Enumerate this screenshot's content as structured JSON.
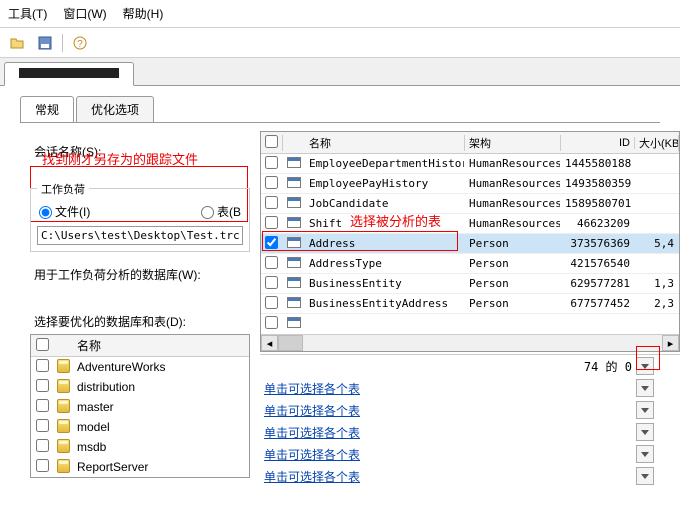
{
  "menu": {
    "tools": "工具(T)",
    "window": "窗口(W)",
    "help": "帮助(H)"
  },
  "tabs": {
    "general": "常规",
    "optimize": "优化选项"
  },
  "session": {
    "label": "会话名称(S):",
    "note_find_file": "找到刚才另存为的跟踪文件",
    "workload_title": "工作负荷",
    "radio_file": "文件(I)",
    "radio_table": "表(B",
    "file_value": "C:\\Users\\test\\Desktop\\Test.trc",
    "db_for_analysis": "用于工作负荷分析的数据库(W):",
    "select_db_tables": "选择要优化的数据库和表(D):"
  },
  "headers": {
    "name": "名称",
    "schema": "架构",
    "id": "ID",
    "size": "大小(KB"
  },
  "note_select_table": "选择被分析的表",
  "tables": [
    {
      "checked": false,
      "name": "EmployeeDepartmentHistory",
      "schema": "HumanResources",
      "id": "1445580188",
      "size": ""
    },
    {
      "checked": false,
      "name": "EmployeePayHistory",
      "schema": "HumanResources",
      "id": "1493580359",
      "size": ""
    },
    {
      "checked": false,
      "name": "JobCandidate",
      "schema": "HumanResources",
      "id": "1589580701",
      "size": ""
    },
    {
      "checked": false,
      "name": "Shift",
      "schema": "HumanResources",
      "id": "46623209",
      "size": ""
    },
    {
      "checked": true,
      "name": "Address",
      "schema": "Person",
      "id": "373576369",
      "size": "5,4",
      "selected": true
    },
    {
      "checked": false,
      "name": "AddressType",
      "schema": "Person",
      "id": "421576540",
      "size": ""
    },
    {
      "checked": false,
      "name": "BusinessEntity",
      "schema": "Person",
      "id": "629577281",
      "size": "1,3"
    },
    {
      "checked": false,
      "name": "BusinessEntityAddress",
      "schema": "Person",
      "id": "677577452",
      "size": "2,3"
    }
  ],
  "dbs": [
    {
      "name": "AdventureWorks"
    },
    {
      "name": "distribution"
    },
    {
      "name": "master"
    },
    {
      "name": "model"
    },
    {
      "name": "msdb"
    },
    {
      "name": "ReportServer"
    }
  ],
  "db_header_name": "名称",
  "bottom_count": "74 的 0",
  "link_text": "单击可选择各个表"
}
